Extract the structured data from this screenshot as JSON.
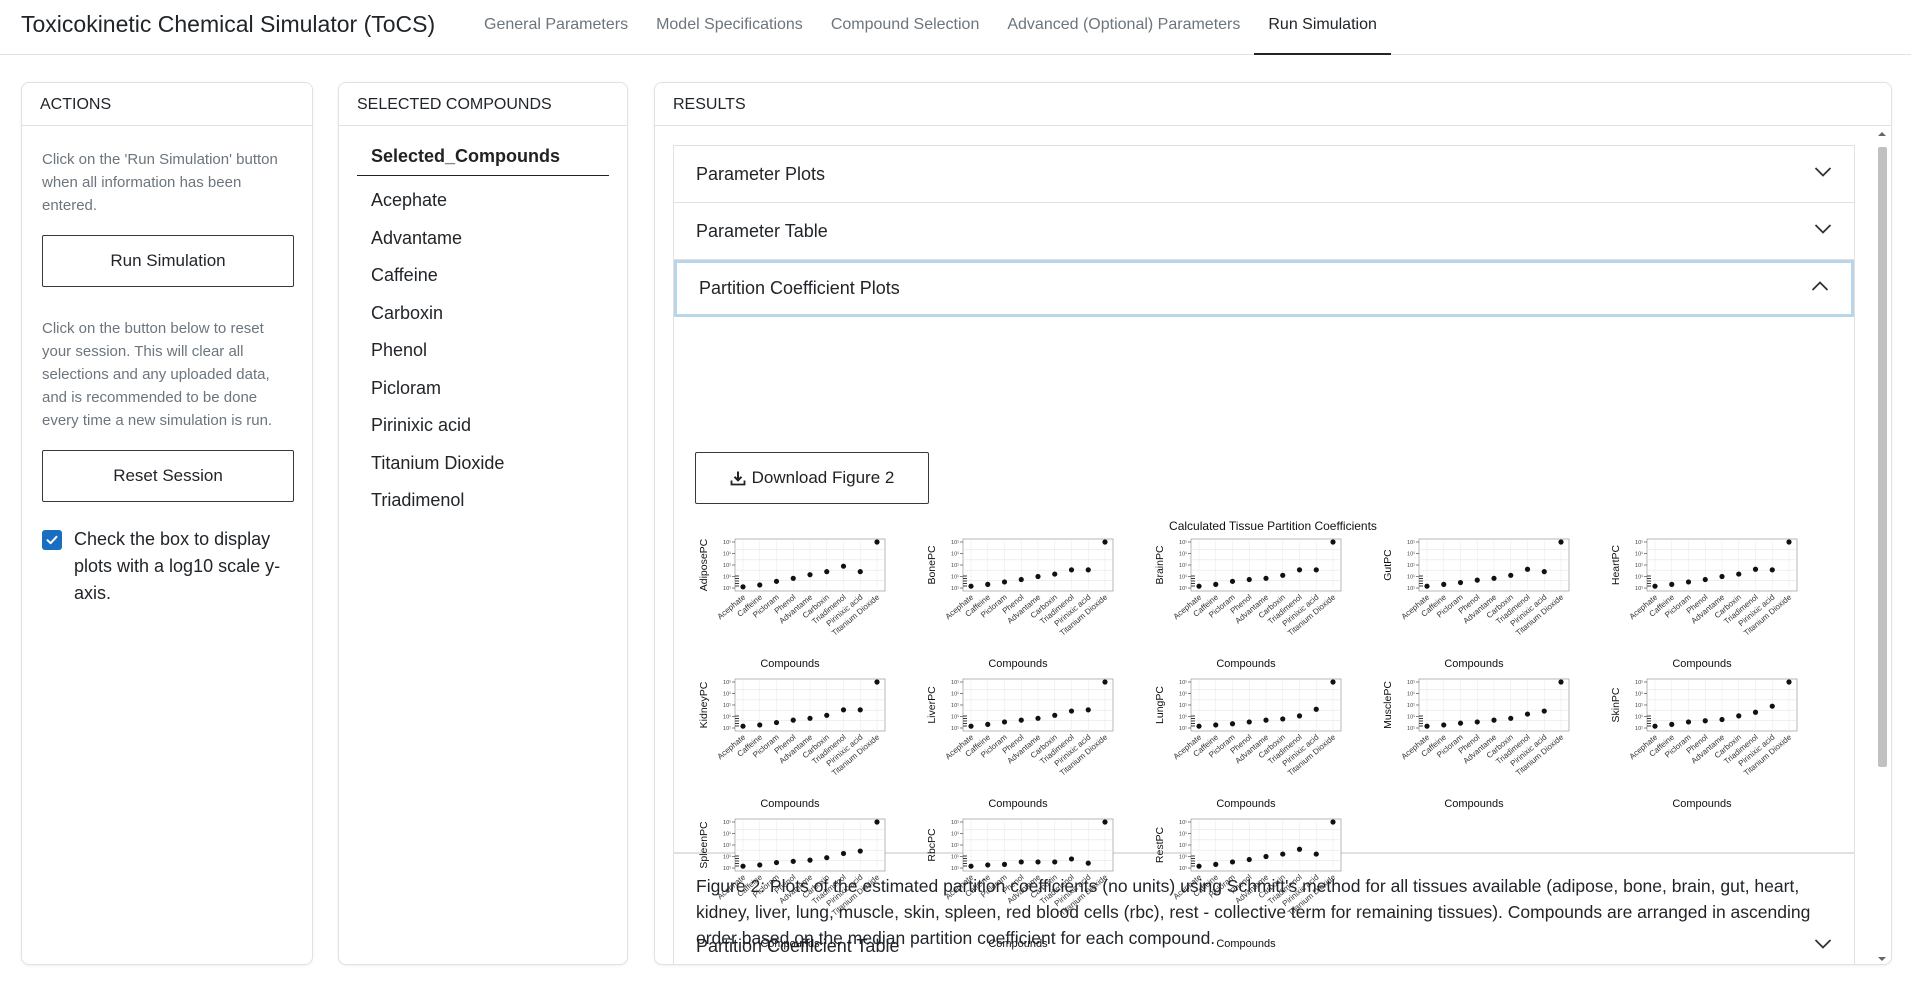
{
  "app": {
    "title": "Toxicokinetic Chemical Simulator (ToCS)"
  },
  "nav": {
    "tabs": [
      {
        "label": "General Parameters"
      },
      {
        "label": "Model Specifications"
      },
      {
        "label": "Compound Selection"
      },
      {
        "label": "Advanced (Optional) Parameters"
      },
      {
        "label": "Run Simulation"
      }
    ],
    "active": 4
  },
  "actions": {
    "header": "ACTIONS",
    "run_help": "Click on the 'Run Simulation' button when all information has been entered.",
    "run_label": "Run Simulation",
    "reset_help": "Click on the button below to reset your session. This will clear all selections and any uploaded data, and is recommended to be done every time a new simulation is run.",
    "reset_label": "Reset Session",
    "log_label": "Check the box to display plots with a log10 scale y-axis.",
    "log_checked": true
  },
  "selected": {
    "header": "SELECTED COMPOUNDS",
    "column": "Selected_Compounds",
    "items": [
      "Acephate",
      "Advantame",
      "Caffeine",
      "Carboxin",
      "Phenol",
      "Picloram",
      "Pirinixic acid",
      "Titanium Dioxide",
      "Triadimenol"
    ]
  },
  "results": {
    "header": "RESULTS",
    "sections": [
      {
        "label": "Parameter Plots"
      },
      {
        "label": "Parameter Table"
      },
      {
        "label": "Partition Coefficient Plots"
      },
      {
        "label": "Partition Coefficient Table"
      }
    ],
    "download_label": "Download Figure 2",
    "caption": "Figure 2: Plots of the estimated partition coefficients (no units) using Schmitt's method for all tissues available (adipose, bone, brain, gut, heart, kidney, liver, lung, muscle, skin, spleen, red blood cells (rbc), rest - collective term for remaining tissues). Compounds are arranged in ascending order based on the median partition coefficient for each compound."
  },
  "figure": {
    "title": "Calculated Tissue Partition Coefficients",
    "xlabel": "Compounds",
    "order": [
      "Acephate",
      "Caffeine",
      "Picloram",
      "Phenol",
      "Advantame",
      "Carboxin",
      "Triadimenol",
      "Pirinixic acid",
      "Titanium Dioxide"
    ],
    "panels": [
      {
        "tissue": "AdiposePC",
        "values": [
          0.2,
          0.5,
          1.1,
          1.6,
          2.2,
          2.7,
          3.6,
          2.7,
          7.6
        ]
      },
      {
        "tissue": "BonePC",
        "values": [
          0.3,
          0.6,
          1.0,
          1.4,
          1.9,
          2.3,
          3.0,
          3.0,
          7.6
        ]
      },
      {
        "tissue": "BrainPC",
        "values": [
          0.3,
          0.6,
          1.1,
          1.4,
          1.6,
          2.1,
          3.0,
          3.0,
          7.6
        ]
      },
      {
        "tissue": "GutPC",
        "values": [
          0.3,
          0.6,
          0.9,
          1.3,
          1.6,
          2.1,
          3.1,
          2.7,
          7.6
        ]
      },
      {
        "tissue": "HeartPC",
        "values": [
          0.3,
          0.6,
          1.0,
          1.4,
          1.9,
          2.3,
          3.1,
          3.0,
          7.6
        ]
      },
      {
        "tissue": "KidneyPC",
        "values": [
          0.3,
          0.5,
          0.9,
          1.3,
          1.6,
          2.1,
          3.0,
          3.0,
          7.6
        ]
      },
      {
        "tissue": "LiverPC",
        "values": [
          0.3,
          0.6,
          1.0,
          1.3,
          1.6,
          2.1,
          2.8,
          3.0,
          7.6
        ]
      },
      {
        "tissue": "LungPC",
        "values": [
          0.3,
          0.5,
          0.7,
          1.0,
          1.3,
          1.5,
          2.0,
          3.1,
          7.6
        ]
      },
      {
        "tissue": "MusclePC",
        "values": [
          0.3,
          0.5,
          0.8,
          1.0,
          1.3,
          1.6,
          2.3,
          2.8,
          7.6
        ]
      },
      {
        "tissue": "SkinPC",
        "values": [
          0.3,
          0.6,
          1.0,
          1.2,
          1.4,
          2.0,
          2.6,
          3.6,
          7.6
        ]
      },
      {
        "tissue": "SpleenPC",
        "values": [
          0.3,
          0.5,
          0.9,
          1.1,
          1.3,
          1.7,
          2.4,
          2.8,
          7.6
        ]
      },
      {
        "tissue": "RbcPC",
        "values": [
          0.3,
          0.5,
          0.6,
          1.0,
          1.0,
          1.0,
          1.5,
          0.8,
          7.6
        ]
      },
      {
        "tissue": "RestPC",
        "values": [
          0.3,
          0.6,
          1.0,
          1.4,
          1.9,
          2.3,
          3.1,
          2.3,
          7.6
        ]
      }
    ]
  }
}
